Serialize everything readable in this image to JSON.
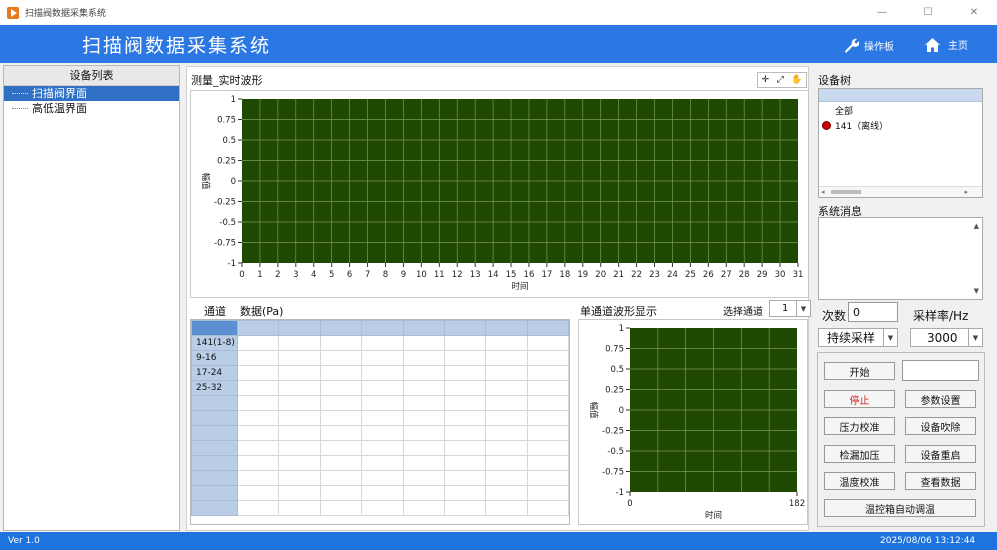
{
  "window": {
    "title": "扫描阀数据采集系统",
    "minimize": "—",
    "maximize": "☐",
    "close": "✕"
  },
  "header": {
    "title": "扫描阀数据采集系统",
    "operation_panel": "操作板",
    "home": "主页"
  },
  "left_panel": {
    "title": "设备列表",
    "items": [
      "扫描阀界面",
      "高低温界面"
    ]
  },
  "wave": {
    "title": "测量_实时波形",
    "tools": [
      "✛",
      "⤢",
      "✋"
    ],
    "ylabel": "幅值",
    "xlabel": "时间",
    "y_ticks": [
      "1",
      "0.75",
      "0.5",
      "0.25",
      "0",
      "-0.25",
      "-0.5",
      "-0.75",
      "-1"
    ],
    "x_ticks": [
      "0",
      "1",
      "2",
      "3",
      "4",
      "5",
      "6",
      "7",
      "8",
      "9",
      "10",
      "11",
      "12",
      "13",
      "14",
      "15",
      "16",
      "17",
      "18",
      "19",
      "20",
      "21",
      "22",
      "23",
      "24",
      "25",
      "26",
      "27",
      "28",
      "29",
      "30",
      "31"
    ]
  },
  "table": {
    "col_channel": "通道",
    "col_data": "数据(Pa)",
    "rows": [
      "141(1-8)",
      "9-16",
      "17-24",
      "25-32"
    ]
  },
  "single_wave": {
    "title": "单通道波形显示",
    "select_label": "选择通道",
    "select_value": "1",
    "ylabel": "幅值",
    "xlabel": "时间",
    "y_ticks": [
      "1",
      "0.75",
      "0.5",
      "0.25",
      "0",
      "-0.25",
      "-0.5",
      "-0.75",
      "-1"
    ],
    "x_ticks": [
      "0",
      "182"
    ]
  },
  "device_tree": {
    "title": "设备树",
    "all": "全部",
    "device": "141（离线）",
    "status_color": "#cc0000"
  },
  "sys_msg": {
    "title": "系统消息"
  },
  "controls": {
    "count_label": "次数",
    "count_value": "0",
    "rate_label": "采样率/Hz",
    "mode_value": "持续采样",
    "rate_value": "3000",
    "start": "开始",
    "stop": "停止",
    "params": "参数设置",
    "pressure_cal": "压力校准",
    "device_purge": "设备吹除",
    "leak_test": "检漏加压",
    "device_restart": "设备重启",
    "temp_cal": "温度校准",
    "view_data": "查看数据",
    "temp_auto": "温控箱自动调温"
  },
  "footer": {
    "version": "Ver 1.0",
    "datetime": "2025/08/06 13:12:44"
  },
  "colors": {
    "header": "#2b78e4",
    "plot_bg": "#1f4800",
    "grid": "#7a9a5a",
    "footer": "#1f73de",
    "stop_text": "#d02020"
  }
}
